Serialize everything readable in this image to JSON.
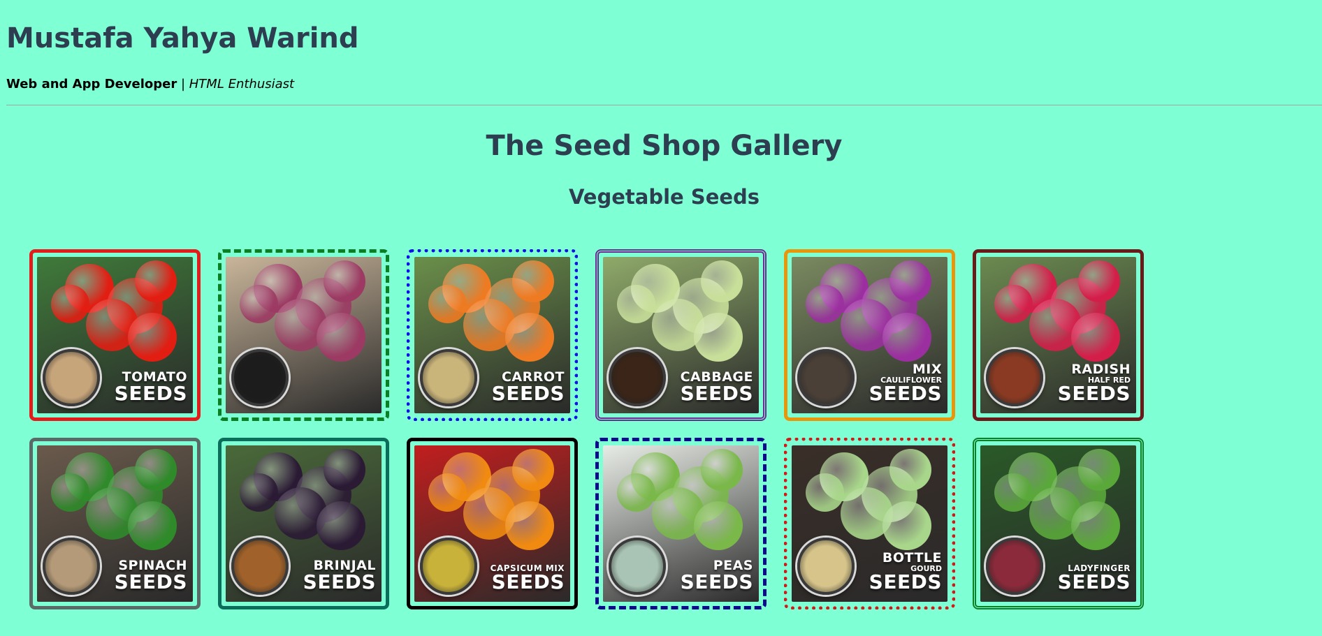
{
  "header": {
    "name": "Mustafa Yahya Warind",
    "role": "Web and App Developer",
    "separator": " | ",
    "interest": "HTML Enthusiast"
  },
  "gallery": {
    "title": "The Seed Shop Gallery",
    "subtitle": "Vegetable Seeds"
  },
  "seeds": [
    {
      "top": "TOMATO",
      "mid": "",
      "bottom": "SEEDS",
      "border_color": "#e41b1b",
      "border_style": "solid",
      "bg": "#3f7a3a",
      "veg": "#e21d12",
      "bowl": "#c7a57b"
    },
    {
      "top": "",
      "mid": "",
      "bottom": "",
      "border_color": "#0a7f24",
      "border_style": "dashed",
      "bg": "#c9b59a",
      "veg": "#9c3a63",
      "bowl": "#1c1c1c"
    },
    {
      "top": "CARROT",
      "mid": "",
      "bottom": "SEEDS",
      "border_color": "#1010e8",
      "border_style": "dotted",
      "bg": "#6a8f4a",
      "veg": "#ee7a22",
      "bowl": "#c9b47a"
    },
    {
      "top": "CABBAGE",
      "mid": "",
      "bottom": "SEEDS",
      "border_color": "#6a2c91",
      "border_style": "double",
      "bg": "#8faa6a",
      "veg": "#c8df9a",
      "bowl": "#3a2518"
    },
    {
      "top": "MIX",
      "mid": "CAULIFLOWER",
      "bottom": "SEEDS",
      "border_color": "#e8960c",
      "border_style": "solid",
      "bg": "#7a8a60",
      "veg": "#9c2fa0",
      "bowl": "#4a4038"
    },
    {
      "top": "RADISH",
      "mid": "HALF RED",
      "bottom": "SEEDS",
      "border_color": "#6b1a1a",
      "border_style": "solid",
      "bg": "#6b8a50",
      "veg": "#d41e4a",
      "bowl": "#8a3a22"
    },
    {
      "top": "SPINACH",
      "mid": "",
      "bottom": "SEEDS",
      "border_color": "#5a6a66",
      "border_style": "solid",
      "bg": "#6a5a4c",
      "veg": "#2f8a2a",
      "bowl": "#b49a78"
    },
    {
      "top": "BRINJAL",
      "mid": "",
      "bottom": "SEEDS",
      "border_color": "#0b6e5a",
      "border_style": "solid",
      "bg": "#4a6a3a",
      "veg": "#2a1a34",
      "bowl": "#a0622a"
    },
    {
      "top": "CAPSICUM MIX",
      "mid": "",
      "bottom": "SEEDS",
      "border_color": "#000000",
      "border_style": "solid",
      "bg": "#c21e1e",
      "veg": "#f08a10",
      "bowl": "#c8b23a"
    },
    {
      "top": "PEAS",
      "mid": "",
      "bottom": "SEEDS",
      "border_color": "#0a0a8a",
      "border_style": "dashed",
      "bg": "#e8ece6",
      "veg": "#7ab84a",
      "bowl": "#a9c4b4"
    },
    {
      "top": "BOTTLE",
      "mid": "GOURD",
      "bottom": "SEEDS",
      "border_color": "#d21818",
      "border_style": "dotted",
      "bg": "#3a2e28",
      "veg": "#a8d68a",
      "bowl": "#d6c48a"
    },
    {
      "top": "LADYFINGER",
      "mid": "",
      "bottom": "SEEDS",
      "border_color": "#0a7f24",
      "border_style": "double",
      "bg": "#2a5a28",
      "veg": "#5aa83a",
      "bowl": "#8a2a3a"
    }
  ]
}
